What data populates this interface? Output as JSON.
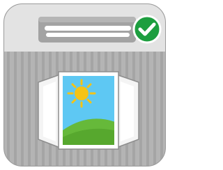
{
  "icon": {
    "name": "window-with-air-conditioner-icon",
    "status": "checked",
    "colors": {
      "frame": "#ffffff",
      "outline": "#9a9a9a",
      "top_panel": "#e3e3e3",
      "wall": "#b4b4b4",
      "wall_stripe": "#a5a5a5",
      "ac_unit": "#a3a3a3",
      "ac_vent": "#ffffff",
      "check_badge": "#1d9e3f",
      "sky": "#5ec8f3",
      "sun": "#f5c315",
      "hill": "#66b93a",
      "shutter": "#f4f4f4"
    }
  }
}
